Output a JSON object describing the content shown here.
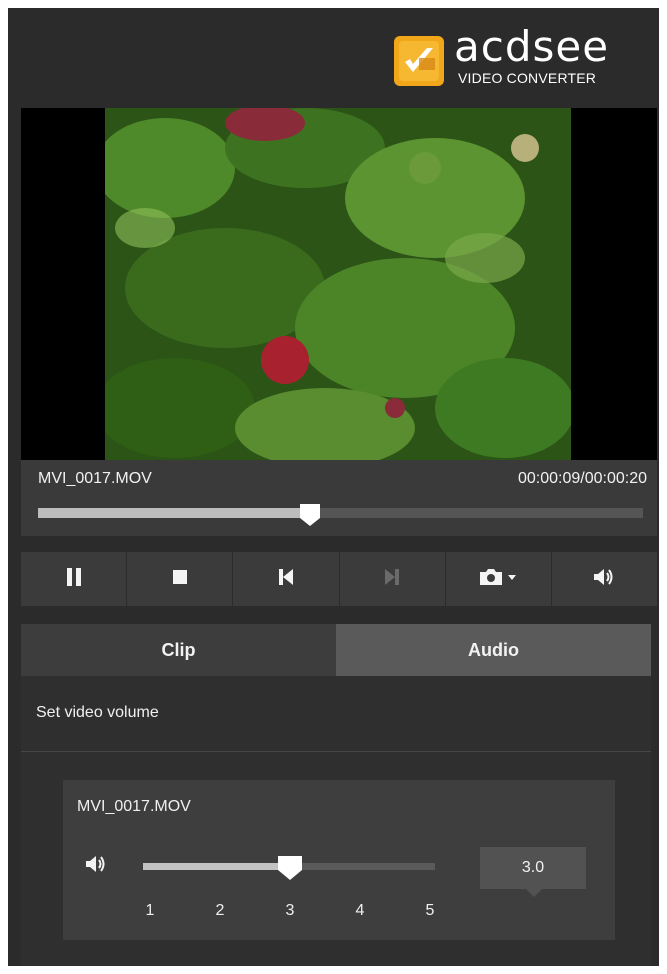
{
  "header": {
    "brand": "acdsee",
    "product": "VIDEO CONVERTER",
    "brand_color": "#f2a71b"
  },
  "player": {
    "filename": "MVI_0017.MOV",
    "timecode": "00:00:09/00:00:20",
    "progress_fraction": 0.45
  },
  "controls": [
    {
      "name": "pause",
      "icon": "pause-icon",
      "enabled": true
    },
    {
      "name": "stop",
      "icon": "stop-icon",
      "enabled": true
    },
    {
      "name": "previous",
      "icon": "skip-back-icon",
      "enabled": true
    },
    {
      "name": "next",
      "icon": "skip-forward-icon",
      "enabled": false
    },
    {
      "name": "snapshot",
      "icon": "camera-icon",
      "enabled": true
    },
    {
      "name": "volume",
      "icon": "speaker-icon",
      "enabled": true
    }
  ],
  "tabs": [
    {
      "label": "Clip",
      "active": false
    },
    {
      "label": "Audio",
      "active": true
    }
  ],
  "audio_panel": {
    "title": "Set video volume",
    "clip_name": "MVI_0017.MOV",
    "volume_value": "3.0",
    "volume_level": 3.0,
    "scale_min": 1,
    "scale_max": 5,
    "ticks": [
      "1",
      "2",
      "3",
      "4",
      "5"
    ]
  }
}
